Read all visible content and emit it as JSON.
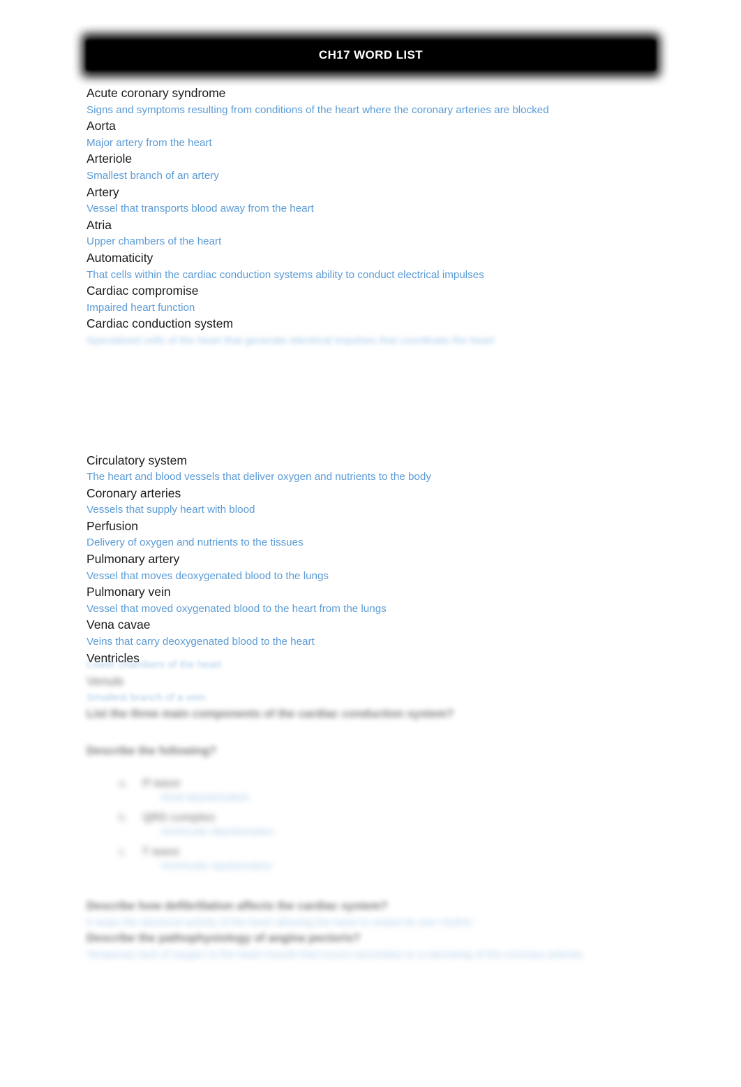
{
  "document": {
    "title": "CH17 WORD LIST"
  },
  "glossary_page_1": [
    {
      "term": "Acute coronary syndrome",
      "definition": "Signs and symptoms resulting from conditions of the heart where the coronary arteries are blocked",
      "blurred": false
    },
    {
      "term": "Aorta",
      "definition": "Major artery from the heart",
      "blurred": false
    },
    {
      "term": "Arteriole",
      "definition": "Smallest branch of an artery",
      "blurred": false
    },
    {
      "term": "Artery",
      "definition": "Vessel that transports blood away from the heart",
      "blurred": false
    },
    {
      "term": "Atria",
      "definition": "Upper chambers of the heart",
      "blurred": false
    },
    {
      "term": "Automaticity",
      "definition": "That cells within the cardiac conduction systems ability to conduct electrical impulses",
      "blurred": false
    },
    {
      "term": "Cardiac compromise",
      "definition": "Impaired heart function",
      "blurred": false
    },
    {
      "term": "Cardiac conduction system",
      "definition": "Specialized cells of the heart that generate electrical impulses that coordinate the heart",
      "blurred": true
    }
  ],
  "glossary_page_2": [
    {
      "term": "Circulatory system",
      "definition": "The heart and blood vessels that deliver oxygen and nutrients to the body",
      "blurred": false,
      "clipped_top": true
    },
    {
      "term": "Coronary arteries",
      "definition": "Vessels that supply heart with blood",
      "blurred": false
    },
    {
      "term": "Perfusion",
      "definition": "Delivery of oxygen and nutrients to the tissues",
      "blurred": false
    },
    {
      "term": "Pulmonary artery",
      "definition": "Vessel that moves deoxygenated blood to the lungs",
      "blurred": false
    },
    {
      "term": "Pulmonary vein",
      "definition": "Vessel that moved oxygenated blood to the heart from the lungs",
      "blurred": false
    },
    {
      "term": "Vena cavae",
      "definition": "Veins that carry deoxygenated blood to the heart",
      "blurred": false
    },
    {
      "term": "Ventricles",
      "definition": "Lower chambers of the heart",
      "blurred": true
    },
    {
      "term": "Venule",
      "definition": "Smallest branch of a vein",
      "blurred": true
    }
  ],
  "questions": {
    "q1": {
      "prompt": "List the three main components of the cardiac conduction system?",
      "blurred": true
    },
    "q2": {
      "prompt": "Describe the following?",
      "blurred": true,
      "items": [
        {
          "marker": "a.",
          "term": "P wave",
          "answer": "Atrial depolarization",
          "blurred": true
        },
        {
          "marker": "b.",
          "term": "QRS complex",
          "answer": "Ventricular depolarization",
          "blurred": true
        },
        {
          "marker": "c.",
          "term": "T wave",
          "answer": "Ventricular repolarization",
          "blurred": true
        }
      ]
    },
    "q3": {
      "prompt": "Describe how defibrillation affects the cardiac system?",
      "answer": "It stops the electrical activity of the heart allowing the heart to restart its own rhythm",
      "blurred": true
    },
    "q4": {
      "prompt": "Describe the pathophysiology of angina pectoris?",
      "answer": "Temporary lack of oxygen to the heart muscle that occurs secondary to a narrowing of the coronary arteries",
      "blurred": true
    }
  },
  "colors": {
    "definition_blue": "#5B9BD5",
    "term_black": "#1A1A1A",
    "banner_background": "#000000",
    "banner_text": "#FFFFFF",
    "page_background": "#FFFFFF"
  }
}
